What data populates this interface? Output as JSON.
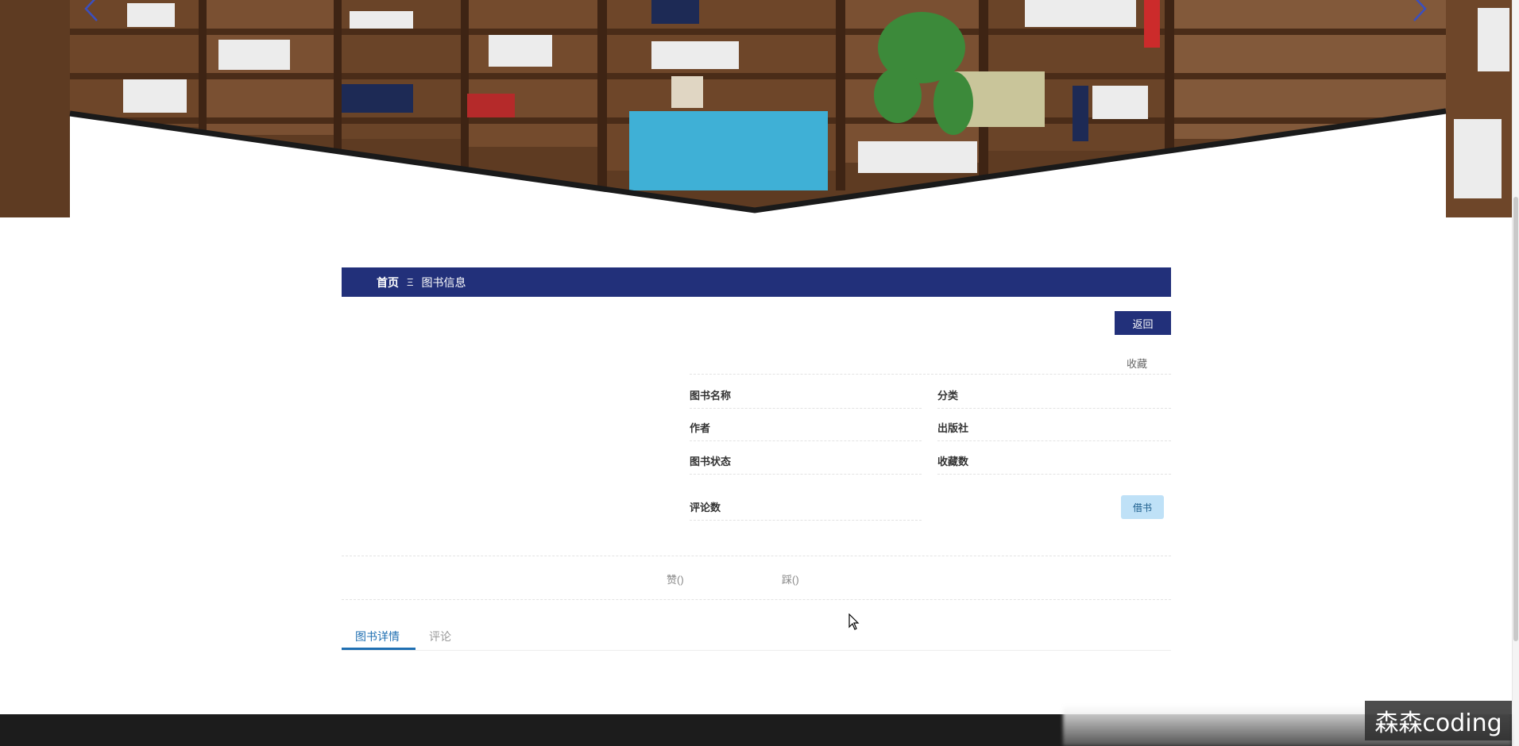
{
  "breadcrumb": {
    "home": "首页",
    "separator": "Ξ",
    "current": "图书信息"
  },
  "actions": {
    "return_label": "返回",
    "favorite_label": "收藏",
    "borrow_label": "借书"
  },
  "book_fields": {
    "name_label": "图书名称",
    "name_value": "",
    "category_label": "分类",
    "category_value": "",
    "author_label": "作者",
    "author_value": "",
    "publisher_label": "出版社",
    "publisher_value": "",
    "status_label": "图书状态",
    "status_value": "",
    "favorites_count_label": "收藏数",
    "favorites_count_value": "",
    "comments_count_label": "评论数",
    "comments_count_value": ""
  },
  "votes": {
    "like_label": "赞()",
    "dislike_label": "踩()"
  },
  "tabs": [
    {
      "label": "图书详情",
      "active": true
    },
    {
      "label": "评论",
      "active": false
    }
  ],
  "watermark": "森森coding",
  "colors": {
    "nav_blue": "#22307a",
    "tab_blue": "#1f6fb2",
    "borrow_bg": "#bfe1f7",
    "footer": "#1c1c1c"
  },
  "icons": {
    "carousel_prev": "chevron-left-icon",
    "carousel_next": "chevron-right-icon",
    "cursor": "mouse-pointer-icon"
  }
}
